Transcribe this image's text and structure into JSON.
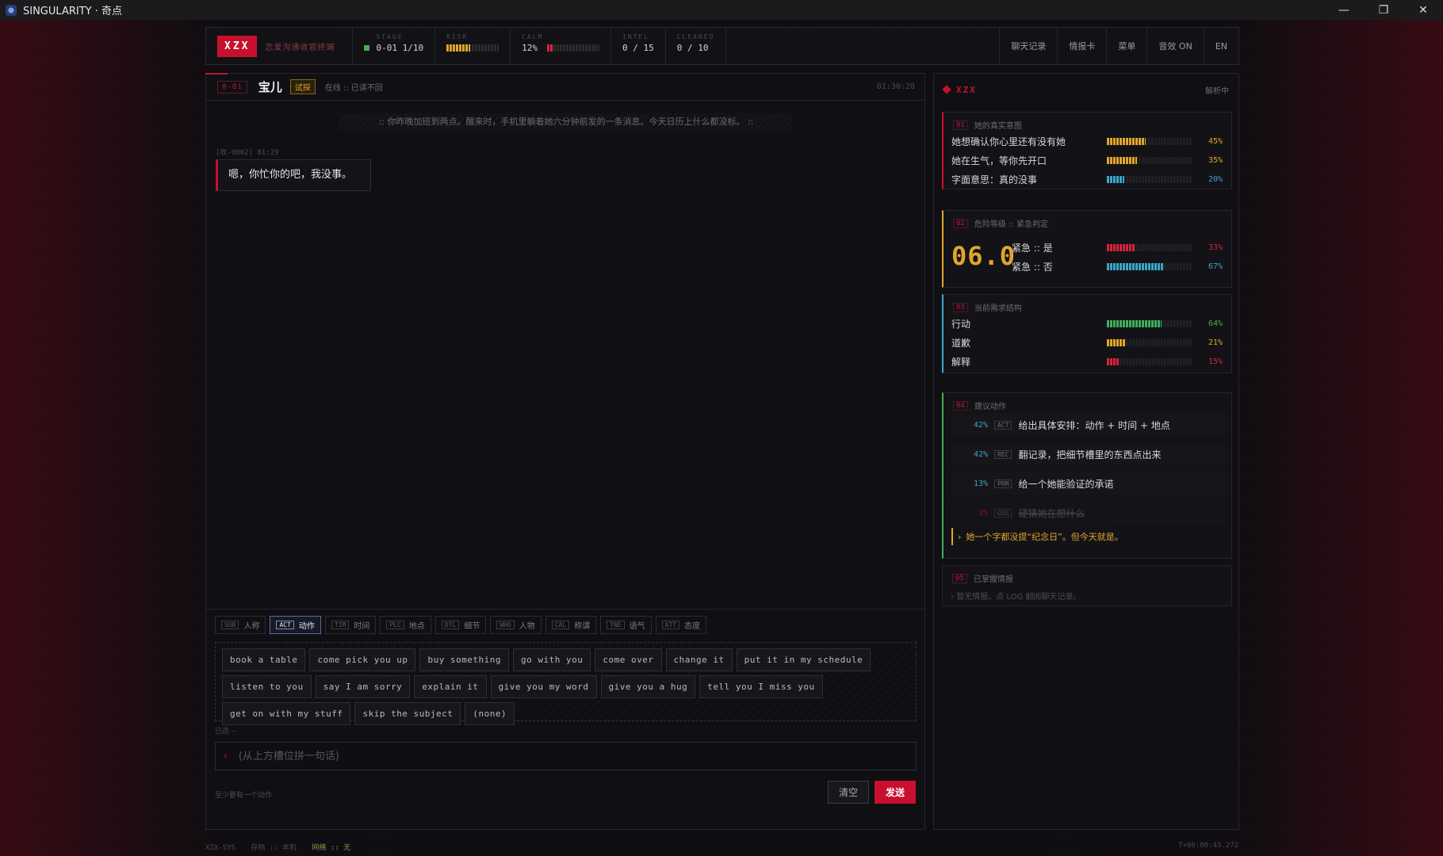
{
  "window": {
    "title": "SINGULARITY · 奇点"
  },
  "header": {
    "logo": "XZX",
    "subtitle": "恋爱沟通收容终端",
    "stage_label": "STAGE",
    "stage_value": "0-01 1/10",
    "risk_label": "RISK",
    "risk_level": 0.45,
    "calm_label": "CALM",
    "calm_value": "12%",
    "calm_level": 0.12,
    "intel_label": "INTEL",
    "intel_value": "0 / 15",
    "cleared_label": "CLEARED",
    "cleared_value": "0 / 10",
    "nav": [
      "聊天记录",
      "情报卡",
      "菜单",
      "音效 ON",
      "EN"
    ]
  },
  "chat": {
    "tag": "0-01",
    "name": "宝儿",
    "badge": "试探",
    "status": "在线 :: 已读不回",
    "timer": "01:30:28",
    "system_message": ":: 你昨晚加班到两点。醒来时，手机里躺着她六分钟前发的一条消息。今天日历上什么都没标。 ::",
    "msg_meta": "[收-0002] 01:29",
    "message": "嗯，你忙你的吧，我没事。"
  },
  "composer": {
    "tabs": [
      {
        "code": "SUB",
        "label": "人称"
      },
      {
        "code": "ACT",
        "label": "动作"
      },
      {
        "code": "TIM",
        "label": "时间"
      },
      {
        "code": "PLC",
        "label": "地点"
      },
      {
        "code": "DTL",
        "label": "细节"
      },
      {
        "code": "WHO",
        "label": "人物"
      },
      {
        "code": "CAL",
        "label": "称谓"
      },
      {
        "code": "TNE",
        "label": "语气"
      },
      {
        "code": "ATT",
        "label": "态度"
      }
    ],
    "chips_row1": [
      "book a table",
      "come pick you up",
      "buy something",
      "go with you",
      "come over",
      "change it",
      "put it in my schedule"
    ],
    "chips_row2": [
      "listen to you",
      "say I am sorry",
      "explain it",
      "give you my word",
      "give you a hug",
      "tell you I miss you"
    ],
    "chips_row3": [
      "get on with my stuff",
      "skip the subject",
      "(none)"
    ],
    "selected": "已选 --",
    "placeholder": "(从上方槽位拼一句话)",
    "hint": "至少要有一个动作",
    "clear": "清空",
    "send": "发送"
  },
  "side": {
    "title": "XZX",
    "status": "解析中",
    "card1": {
      "num": "01",
      "title": "她的真实意图",
      "rows": [
        {
          "label": "她想确认你心里还有没有她",
          "pct": "45%",
          "value": 0.45,
          "color": "#e2a52b"
        },
        {
          "label": "她在生气，等你先开口",
          "pct": "35%",
          "value": 0.35,
          "color": "#e2a52b"
        },
        {
          "label": "字面意思：真的没事",
          "pct": "20%",
          "value": 0.2,
          "color": "#3aa6c8"
        }
      ]
    },
    "card2": {
      "num": "02",
      "title": "危险等级 :: 紧急判定",
      "score": "06.0",
      "rows": [
        {
          "label": "紧急 :: 是",
          "pct": "33%",
          "value": 0.33,
          "color": "#d8233a"
        },
        {
          "label": "紧急 :: 否",
          "pct": "67%",
          "value": 0.67,
          "color": "#3aa6c8"
        }
      ]
    },
    "card3": {
      "num": "03",
      "title": "当前需求结构",
      "rows": [
        {
          "label": "行动",
          "pct": "64%",
          "value": 0.64,
          "color": "#3fae5a"
        },
        {
          "label": "道歉",
          "pct": "21%",
          "value": 0.21,
          "color": "#e2a52b"
        },
        {
          "label": "解释",
          "pct": "15%",
          "value": 0.15,
          "color": "#d8233a"
        }
      ]
    },
    "card4": {
      "num": "04",
      "title": "建议动作",
      "items": [
        {
          "pct": "42%",
          "code": "ACT",
          "text": "给出具体安排：动作 + 时间 + 地点",
          "color": "#3aa6c8"
        },
        {
          "pct": "42%",
          "code": "REC",
          "text": "翻记录，把细节槽里的东西点出来",
          "color": "#3aa6c8"
        },
        {
          "pct": "13%",
          "code": "PRM",
          "text": "给一个她能验证的承诺",
          "color": "#3aa6c8"
        },
        {
          "pct": "3%",
          "code": "GUS",
          "text": "硬猜她在想什么",
          "color": "#c8102e"
        }
      ],
      "note": "她一个字都没提“纪念日”。但今天就是。"
    },
    "card5": {
      "num": "05",
      "title": "已掌握情报",
      "empty": "暂无情报。点 LOG 翻阅聊天记录。"
    }
  },
  "footer": {
    "left_id": "XZX-SYS",
    "storage": "存档 :: 本机",
    "network": "网络 :: 无",
    "right": "T+00:00:43.272"
  }
}
